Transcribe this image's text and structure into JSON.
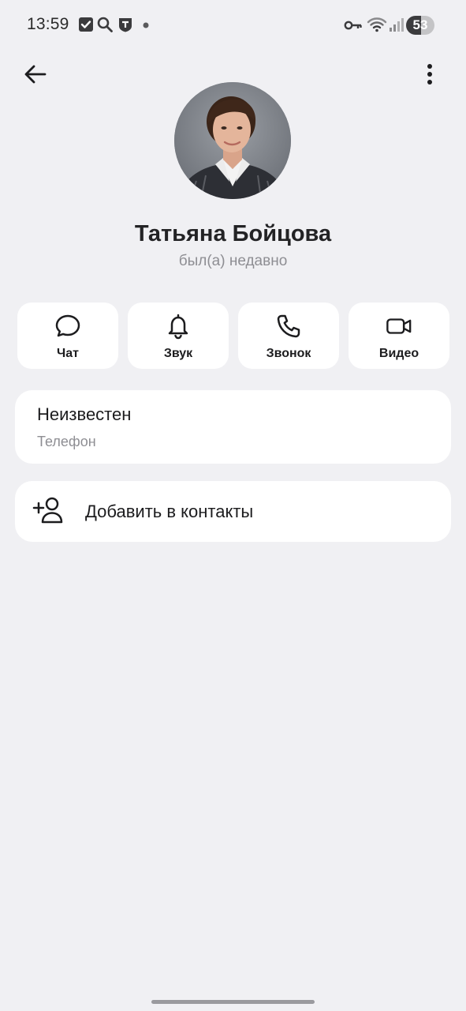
{
  "status_bar": {
    "time": "13:59",
    "battery_level": "53",
    "battery_fraction": 0.53,
    "left_icons": [
      "checkbox-icon",
      "search-icon",
      "shield-t-icon",
      "dot-icon"
    ],
    "right_icons": [
      "key-icon",
      "wifi-icon",
      "signal-icon"
    ]
  },
  "header": {
    "back_icon": "arrow-left-icon",
    "menu_icon": "more-vertical-icon"
  },
  "profile": {
    "name": "Татьяна Бойцова",
    "status": "был(а) недавно"
  },
  "actions": [
    {
      "label": "Чат",
      "icon": "chat-bubble-icon"
    },
    {
      "label": "Звук",
      "icon": "bell-icon"
    },
    {
      "label": "Звонок",
      "icon": "phone-icon"
    },
    {
      "label": "Видео",
      "icon": "video-camera-icon"
    }
  ],
  "phone_card": {
    "value": "Неизвестен",
    "label": "Телефон"
  },
  "add_contact": {
    "label": "Добавить в контакты",
    "icon": "add-person-icon"
  },
  "colors": {
    "background": "#f0f0f3",
    "card": "#ffffff",
    "text": "#1c1c1e",
    "secondary_text": "#8e8e93"
  }
}
